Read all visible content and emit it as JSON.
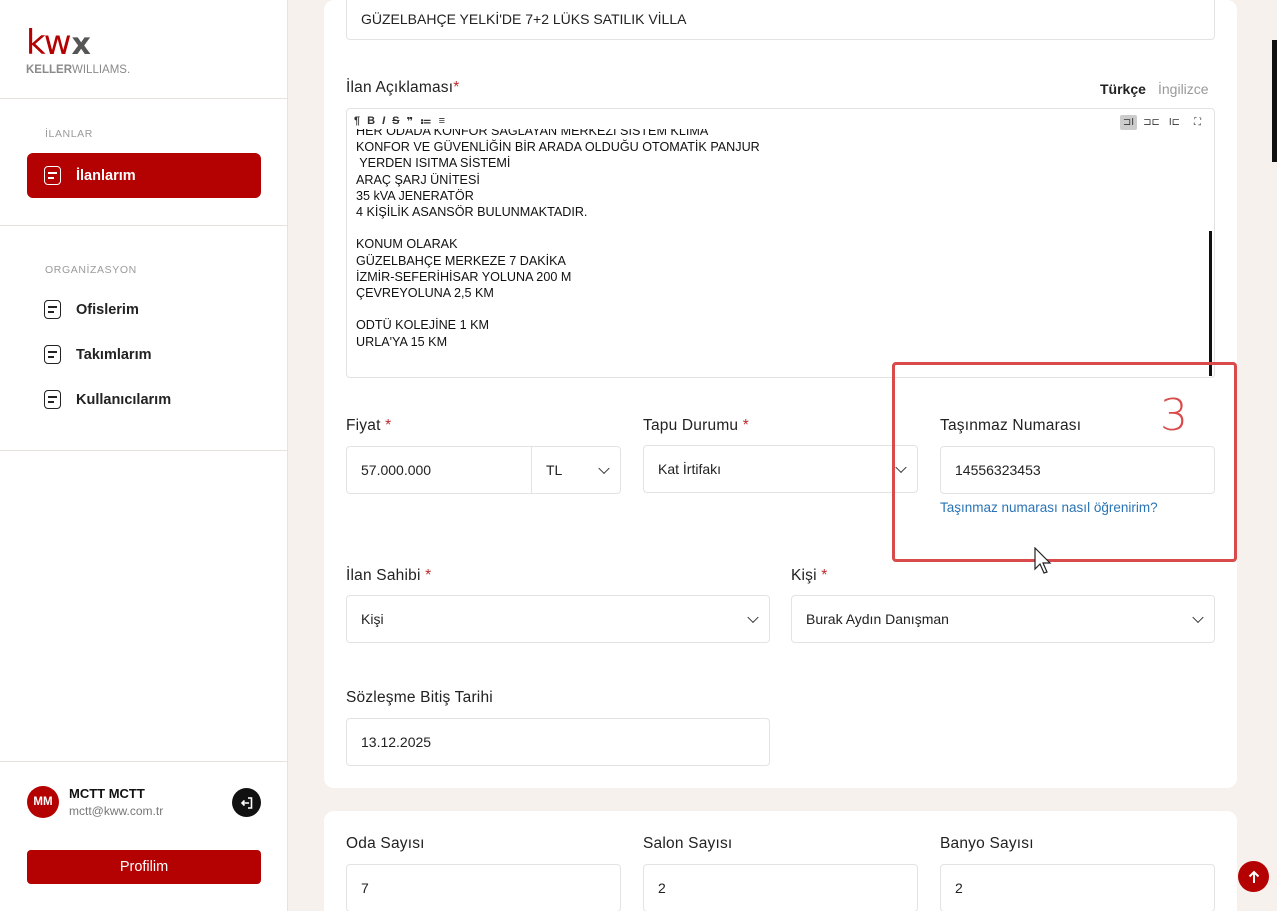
{
  "sidebar": {
    "logo_kw": "kw",
    "logo_x": "x",
    "logo_brand_bold": "KELLER",
    "logo_brand_rest": "WILLIAMS.",
    "sections": [
      {
        "title": "İLANLAR"
      },
      {
        "title": "ORGANİZASYON"
      }
    ],
    "items": [
      {
        "label": "İlanlarım",
        "active": true
      },
      {
        "label": "Ofislerim"
      },
      {
        "label": "Takımlarım"
      },
      {
        "label": "Kullanıcılarım"
      }
    ],
    "user": {
      "initials": "MM",
      "name": "MCTT MCTT",
      "email": "mctt@kww.com.tr"
    },
    "profile_button": "Profilim"
  },
  "form": {
    "title_value": "GÜZELBAHÇE YELKİ'DE 7+2 LÜKS SATILIK VİLLA",
    "description": {
      "label": "İlan Açıklaması",
      "lang_active": "Türkçe",
      "lang_other": "İngilizce",
      "toolbar": [
        "¶",
        "B",
        "I",
        "S",
        "❞",
        "≔",
        "≡"
      ],
      "text": "HER ODADA KONFOR SAĞLAYAN MERKEZİ SİSTEM KLİMA\nKONFOR VE GÜVENLİĞİN BİR ARADA OLDUĞU OTOMATİK PANJUR\n YERDEN ISITMA SİSTEMİ\nARAÇ ŞARJ ÜNİTESİ\n35 kVA JENERATÖR\n4 KİŞİLİK ASANSÖR BULUNMAKTADIR.\n\nKONUM OLARAK\nGÜZELBAHÇE MERKEZE 7 DAKİKA\nİZMİR-SEFERİHİSAR YOLUNA 200 M\nÇEVREYOLUNA 2,5 KM\n\nODTÜ KOLEJİNE 1 KM\nURLA'YA 15 KM"
    },
    "price": {
      "label": "Fiyat",
      "value": "57.000.000",
      "currency": "TL"
    },
    "deed": {
      "label": "Tapu Durumu",
      "value": "Kat İrtifakı"
    },
    "property_number": {
      "label": "Taşınmaz Numarası",
      "value": "14556323453",
      "help_link": "Taşınmaz numarası nasıl öğrenirim?"
    },
    "owner": {
      "label": "İlan Sahibi",
      "value": "Kişi"
    },
    "person": {
      "label": "Kişi",
      "value": "Burak Aydın Danışman"
    },
    "contract_end": {
      "label": "Sözleşme Bitiş Tarihi",
      "value": "13.12.2025"
    },
    "rooms": {
      "label": "Oda Sayısı",
      "value": "7"
    },
    "salons": {
      "label": "Salon Sayısı",
      "value": "2"
    },
    "baths": {
      "label": "Banyo Sayısı",
      "value": "2"
    },
    "required_mark": "*"
  },
  "annotation": {
    "number": "3",
    "color": "#d94a4a"
  },
  "colors": {
    "brand": "#b40101",
    "link": "#2a74b5"
  }
}
